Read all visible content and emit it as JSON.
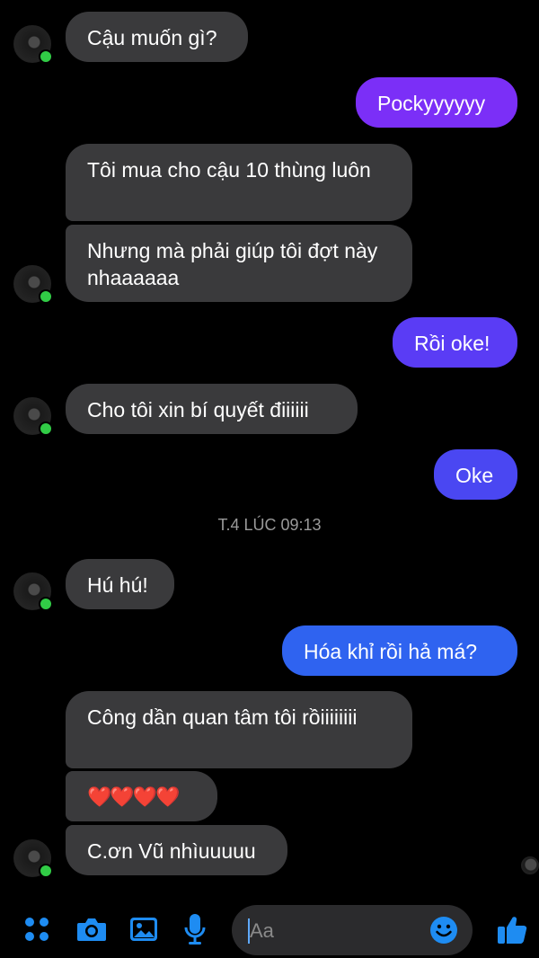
{
  "conversation": {
    "messages": [
      {
        "from": "other",
        "text": "Cậu muốn gì?"
      },
      {
        "from": "me",
        "text": "Pockyyyyyy"
      },
      {
        "from": "other",
        "text": "Tôi mua cho cậu 10 thùng luôn"
      },
      {
        "from": "other",
        "text": "Nhưng mà phải giúp tôi đợt này nhaaaaaa"
      },
      {
        "from": "me",
        "text": "Rồi oke!"
      },
      {
        "from": "other",
        "text": "Cho tôi xin bí quyết điiiiii"
      },
      {
        "from": "me",
        "text": "Oke"
      },
      {
        "from": "other",
        "text": "Hú hú!"
      },
      {
        "from": "me",
        "text": "Hóa khỉ rồi hả má?"
      },
      {
        "from": "other",
        "text": "Công dần quan tâm tôi rồiiiiiiii"
      },
      {
        "from": "other",
        "text": "❤️❤️❤️❤️"
      },
      {
        "from": "other",
        "text": "C.ơn Vũ nhìuuuuu"
      }
    ],
    "timestamp": "T.4 LÚC 09:13"
  },
  "composer": {
    "placeholder": "Aa"
  },
  "icons": {
    "menu": "grid-dots-icon",
    "camera": "camera-icon",
    "gallery": "image-icon",
    "mic": "microphone-icon",
    "emoji": "emoji-icon",
    "like": "thumbs-up-icon"
  },
  "colors": {
    "background": "#000000",
    "incoming_bubble": "#3a3a3c",
    "outgoing_purple": "#7b2ff7",
    "outgoing_blue": "#2f63f0",
    "accent_blue": "#1e8cf2",
    "online_dot": "#31cc46"
  }
}
